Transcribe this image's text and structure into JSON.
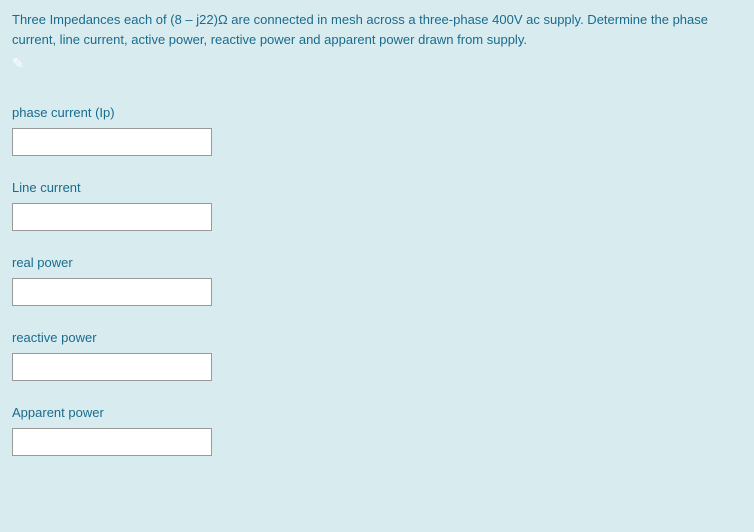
{
  "question": "Three Impedances each of (8 – j22)Ω are connected in mesh across a three-phase 400V ac supply. Determine the phase current, line current, active power, reactive power and apparent power drawn from supply.",
  "fields": [
    {
      "label": "phase current (Ip)",
      "value": ""
    },
    {
      "label": "Line current",
      "value": ""
    },
    {
      "label": "real power",
      "value": ""
    },
    {
      "label": "reactive power",
      "value": ""
    },
    {
      "label": "Apparent power",
      "value": ""
    }
  ]
}
